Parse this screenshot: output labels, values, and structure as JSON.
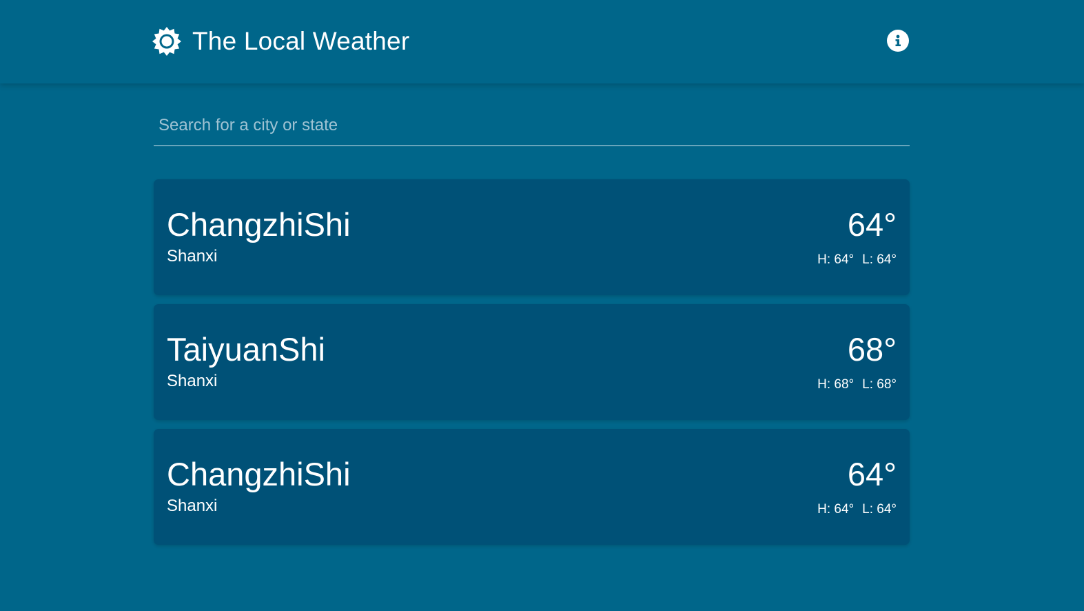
{
  "header": {
    "title": "The Local Weather",
    "logo_icon": "sun-icon",
    "info_icon": "info-icon"
  },
  "search": {
    "placeholder": "Search for a city or state",
    "value": ""
  },
  "locations": [
    {
      "city": "ChangzhiShi",
      "region": "Shanxi",
      "temp": "64°",
      "high": "H: 64°",
      "low": "L: 64°"
    },
    {
      "city": "TaiyuanShi",
      "region": "Shanxi",
      "temp": "68°",
      "high": "H: 68°",
      "low": "L: 68°"
    },
    {
      "city": "ChangzhiShi",
      "region": "Shanxi",
      "temp": "64°",
      "high": "H: 64°",
      "low": "L: 64°"
    }
  ],
  "colors": {
    "background": "#00668a",
    "card": "#005177",
    "text": "#ffffff",
    "placeholder": "#9fc3d3"
  }
}
